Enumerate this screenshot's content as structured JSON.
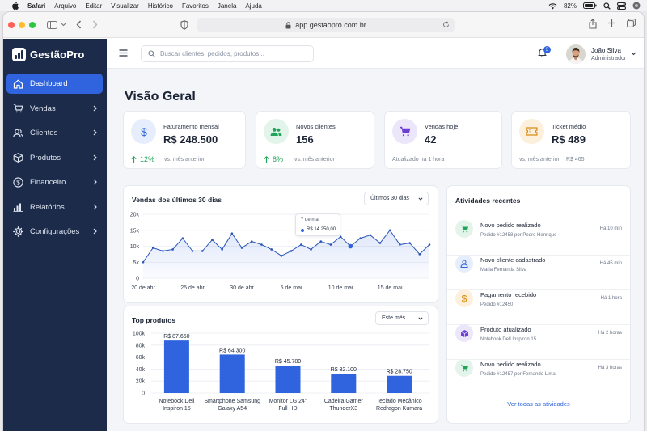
{
  "menubar": {
    "items": [
      "Safari",
      "Arquivo",
      "Editar",
      "Visualizar",
      "Histórico",
      "Favoritos",
      "Janela",
      "Ajuda"
    ],
    "battery": "82%"
  },
  "browser": {
    "url": "app.gestaopro.com.br"
  },
  "app": {
    "name": "GestãoPro"
  },
  "sidebar": {
    "items": [
      {
        "label": "Dashboard",
        "icon": "home-icon",
        "active": true
      },
      {
        "label": "Vendas",
        "icon": "cart-icon"
      },
      {
        "label": "Clientes",
        "icon": "users-icon"
      },
      {
        "label": "Produtos",
        "icon": "box-icon"
      },
      {
        "label": "Financeiro",
        "icon": "dollar-icon"
      },
      {
        "label": "Relatórios",
        "icon": "bar-chart-icon"
      },
      {
        "label": "Configurações",
        "icon": "gear-icon"
      }
    ]
  },
  "header": {
    "search_placeholder": "Buscar clientes, pedidos, produtos...",
    "notifications": "3",
    "user_name": "João Silva",
    "user_role": "Administrador"
  },
  "page": {
    "title": "Visão Geral"
  },
  "kpis": [
    {
      "label": "Faturamento mensal",
      "value": "R$ 248.500",
      "trend": "12%",
      "sub": "vs. mês anterior",
      "icon": "dollar-icon",
      "color": "#2f64de",
      "bg": "#e6edfc"
    },
    {
      "label": "Novos clientes",
      "value": "156",
      "trend": "8%",
      "sub": "vs. mês anterior",
      "icon": "users-icon",
      "color": "#21a35a",
      "bg": "#e3f5ea"
    },
    {
      "label": "Vendas hoje",
      "value": "42",
      "trend": "",
      "sub": "Atualizado há 1 hora",
      "icon": "cart-icon",
      "color": "#6b3fd4",
      "bg": "#ece6fa"
    },
    {
      "label": "Ticket médio",
      "value": "R$ 489",
      "trend": "",
      "sub": "vs. mês anterior",
      "sub_value": "R$ 465",
      "icon": "ticket-icon",
      "color": "#d98c12",
      "bg": "#fcf0dc"
    }
  ],
  "sales_chart": {
    "title": "Vendas dos últimos 30 dias",
    "filter": "Últimos 30 dias",
    "tooltip_date": "7 de mai",
    "tooltip_value": "R$ 14.250,00"
  },
  "products_chart": {
    "title": "Top produtos",
    "filter": "Este mês"
  },
  "chart_data": [
    {
      "type": "line",
      "title": "Vendas dos últimos 30 dias",
      "x": [
        "20 de abr",
        "21 de abr",
        "22 de abr",
        "23 de abr",
        "24 de abr",
        "25 de abr",
        "26 de abr",
        "27 de abr",
        "28 de abr",
        "29 de abr",
        "30 de abr",
        "1 de mai",
        "2 de mai",
        "3 de mai",
        "4 de mai",
        "5 de mai",
        "6 de mai",
        "7 de mai",
        "8 de mai",
        "9 de mai",
        "10 de mai",
        "11 de mai",
        "12 de mai",
        "13 de mai",
        "14 de mai",
        "15 de mai",
        "16 de mai",
        "17 de mai",
        "18 de mai",
        "19 de mai"
      ],
      "values": [
        5000,
        9500,
        8500,
        9000,
        12500,
        8500,
        8500,
        12000,
        9000,
        14000,
        9500,
        11500,
        10500,
        9000,
        7000,
        8500,
        10500,
        9000,
        11500,
        10500,
        13000,
        10000,
        12500,
        13500,
        11000,
        15000,
        10500,
        11000,
        7500,
        10500
      ],
      "xticks": [
        "20 de abr",
        "25 de abr",
        "30 de abr",
        "5 de mai",
        "10 de mai",
        "15 de mai"
      ],
      "yticks": [
        "0",
        "5k",
        "10k",
        "15k",
        "20k"
      ],
      "ylim": [
        0,
        20000
      ],
      "highlight": {
        "x": "7 de mai",
        "index": 21,
        "value": 12500
      },
      "grid": true,
      "color": "#2f64de"
    },
    {
      "type": "bar",
      "title": "Top produtos",
      "categories": [
        "Notebook Dell Inspiron 15",
        "Smartphone Samsung Galaxy A54",
        "Monitor LG 24\" Full HD",
        "Cadeira Gamer ThunderX3",
        "Teclado Mecânico Redragon Kumara"
      ],
      "category_lines": [
        [
          "Notebook Dell",
          "Inspiron 15"
        ],
        [
          "Smartphone Samsung",
          "Galaxy A54"
        ],
        [
          "Monitor LG 24\"",
          "Full HD"
        ],
        [
          "Cadeira Gamer",
          "ThunderX3"
        ],
        [
          "Teclado Mecânico",
          "Redragon Kumara"
        ]
      ],
      "values": [
        87650,
        64300,
        45780,
        32100,
        28750
      ],
      "labels": [
        "R$ 87.650",
        "R$ 64.300",
        "R$ 45.780",
        "R$ 32.100",
        "R$ 28.750"
      ],
      "yticks": [
        "0",
        "20k",
        "40k",
        "60k",
        "80k",
        "100k"
      ],
      "ylim": [
        0,
        100000
      ],
      "grid": true,
      "color": "#2f64de"
    }
  ],
  "activities": {
    "title": "Atividades recentes",
    "items": [
      {
        "title": "Novo pedido realizado",
        "sub": "Pedido #12458 por Pedro Henrique",
        "time": "Há 10 min",
        "icon": "cart-icon",
        "color": "#21a35a",
        "bg": "#e3f5ea"
      },
      {
        "title": "Novo cliente cadastrado",
        "sub": "Maria Fernanda Silva",
        "time": "Há 45 min",
        "icon": "user-icon",
        "color": "#2f64de",
        "bg": "#e6edfc"
      },
      {
        "title": "Pagamento recebido",
        "sub": "Pedido #12450",
        "time": "Há 1 hora",
        "icon": "dollar-icon",
        "color": "#d98c12",
        "bg": "#fcf0dc"
      },
      {
        "title": "Produto atualizado",
        "sub": "Notebook Dell Inspiron 15",
        "time": "Há 2 horas",
        "icon": "box-icon",
        "color": "#6b3fd4",
        "bg": "#ece6fa"
      },
      {
        "title": "Novo pedido realizado",
        "sub": "Pedido #12457 por Fernando Lima",
        "time": "Há 3 horas",
        "icon": "cart-icon",
        "color": "#21a35a",
        "bg": "#e3f5ea"
      }
    ],
    "view_all": "Ver todas as atividades"
  }
}
